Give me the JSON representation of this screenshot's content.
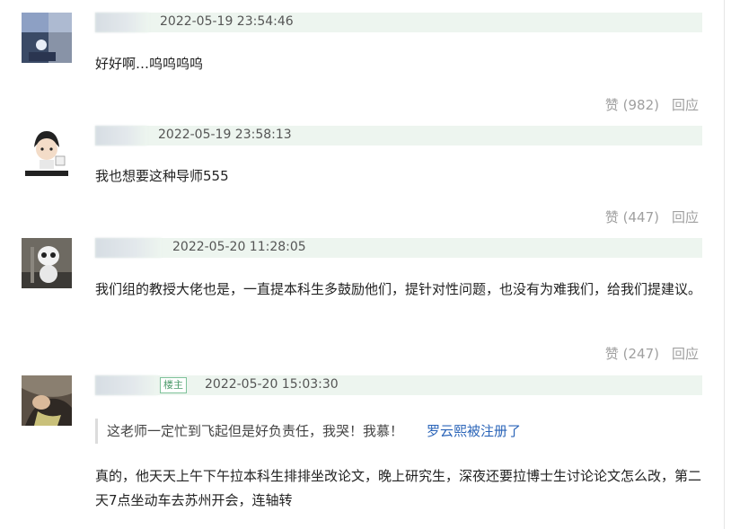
{
  "comments": [
    {
      "timestamp": "2022-05-19 23:54:46",
      "text": "好好啊…呜呜呜呜",
      "like_label": "赞 (982)",
      "reply_label": "回应"
    },
    {
      "timestamp": "2022-05-19 23:58:13",
      "text": "我也想要这种导师555",
      "like_label": "赞 (447)",
      "reply_label": "回应"
    },
    {
      "timestamp": "2022-05-20 11:28:05",
      "text": "我们组的教授大佬也是，一直提本科生多鼓励他们，提针对性问题，也没有为难我们，给我们提建议。",
      "like_label": "赞 (247)",
      "reply_label": "回应"
    },
    {
      "timestamp": "2022-05-20 15:03:30",
      "op_badge": "楼主",
      "quote_text": "这老师一定忙到飞起但是好负责任，我哭！我慕！",
      "quote_author": "罗云熙被注册了",
      "text": "真的，他天天上午下午拉本科生排排坐改论文，晚上研究生，深夜还要拉博士生讨论论文怎么改，第二天7点坐动车去苏州开会，连轴转"
    }
  ],
  "colors": {
    "header_bg": "#edf5ef",
    "link": "#2a64b8",
    "muted": "#a0a0a0",
    "badge": "#4c9a6a"
  }
}
